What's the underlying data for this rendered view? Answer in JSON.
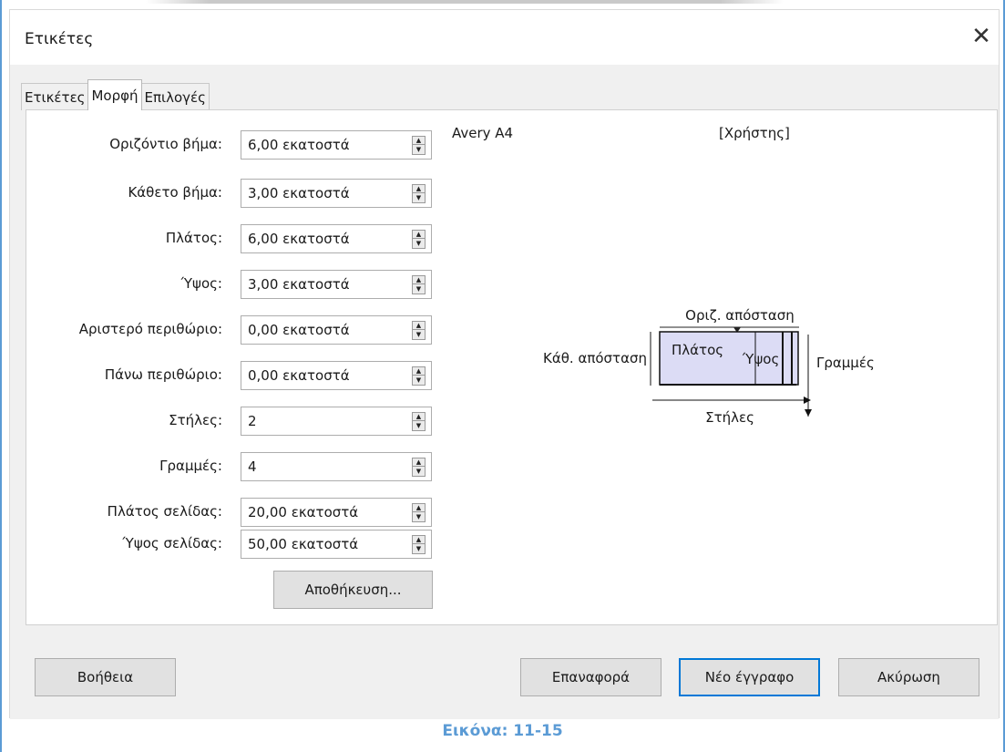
{
  "window": {
    "title": "Ετικέτες",
    "close_glyph": "✕"
  },
  "tabs": [
    {
      "label": "Ετικέτες"
    },
    {
      "label": "Μορφή"
    },
    {
      "label": "Επιλογές"
    }
  ],
  "fields": [
    {
      "label": "Οριζόντιο βήμα:",
      "value": "6,00 εκατοστά"
    },
    {
      "label": "Κάθετο βήμα:",
      "value": "3,00 εκατοστά"
    },
    {
      "label": "Πλάτος:",
      "value": "6,00 εκατοστά"
    },
    {
      "label": "Ύψος:",
      "value": "3,00 εκατοστά"
    },
    {
      "label": "Αριστερό περιθώριο:",
      "value": "0,00 εκατοστά"
    },
    {
      "label": "Πάνω περιθώριο:",
      "value": "0,00 εκατοστά"
    },
    {
      "label": "Στήλες:",
      "value": "2"
    },
    {
      "label": "Γραμμές:",
      "value": "4"
    },
    {
      "label": "Πλάτος σελίδας:",
      "value": "20,00 εκατοστά"
    },
    {
      "label": "Ύψος σελίδας:",
      "value": "50,00 εκατοστά"
    }
  ],
  "save_button": "Αποθήκευση...",
  "info": {
    "brand": "Avery A4",
    "type": "[Χρήστης]"
  },
  "diagram": {
    "horizontal_gap": "Οριζ. απόσταση",
    "vertical_gap": "Κάθ. απόσταση",
    "width": "Πλάτος",
    "height": "Ύψος",
    "rows": "Γραμμές",
    "columns": "Στήλες"
  },
  "footer": {
    "help": "Βοήθεια",
    "reset": "Επαναφορά",
    "new_document": "Νέο έγγραφο",
    "cancel": "Ακύρωση"
  },
  "caption": "Εικόνα: 11-15",
  "colors": {
    "accent": "#0078d7",
    "caption": "#5b9bd5",
    "diagram_fill": "#dcdcf5"
  }
}
